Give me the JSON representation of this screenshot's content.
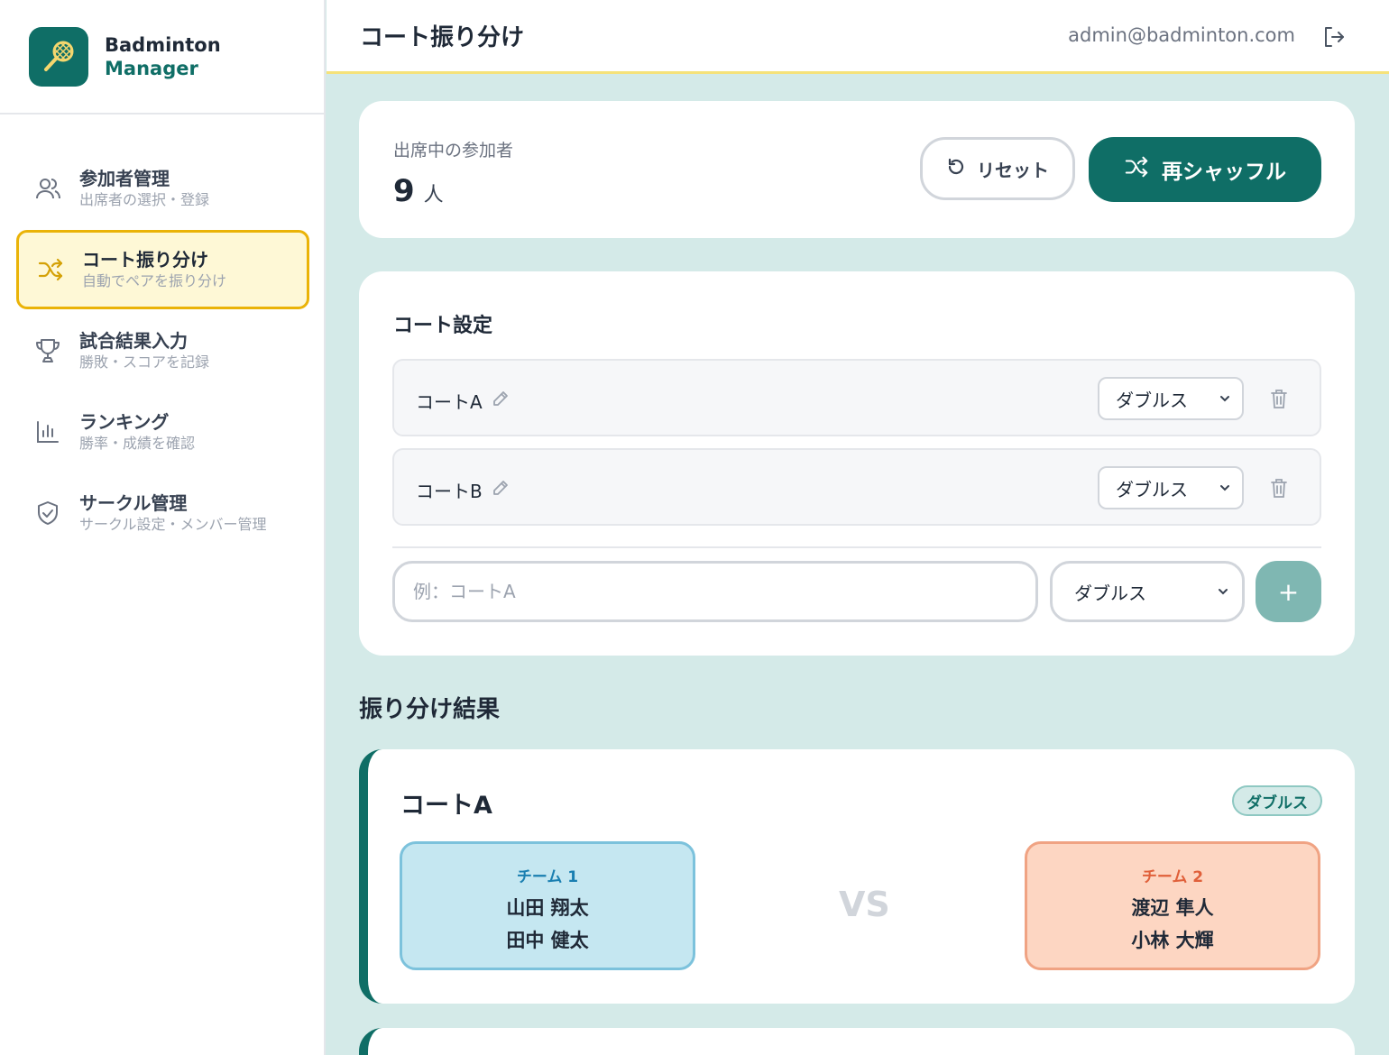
{
  "brand": {
    "line1": "Badminton",
    "line2": "Manager",
    "logo_icon": "badminton-racket-icon"
  },
  "colors": {
    "primary": "#0f6e66",
    "active_nav_bg": "#fef8d6",
    "active_nav_border": "#eab308",
    "team1": "#c5e7f1",
    "team2": "#fdd6c2"
  },
  "sidebar": {
    "items": [
      {
        "title": "参加者管理",
        "sub": "出席者の選択・登録",
        "icon": "users-icon"
      },
      {
        "title": "コート振り分け",
        "sub": "自動でペアを振り分け",
        "icon": "shuffle-icon"
      },
      {
        "title": "試合結果入力",
        "sub": "勝敗・スコアを記録",
        "icon": "trophy-icon"
      },
      {
        "title": "ランキング",
        "sub": "勝率・成績を確認",
        "icon": "bar-chart-icon"
      },
      {
        "title": "サークル管理",
        "sub": "サークル設定・メンバー管理",
        "icon": "shield-icon"
      }
    ]
  },
  "header": {
    "title": "コート振り分け",
    "email": "admin@badminton.com"
  },
  "attendance": {
    "label": "出席中の参加者",
    "count": "9",
    "unit": "人",
    "reset_label": "リセット",
    "shuffle_label": "再シャッフル"
  },
  "court_settings": {
    "title": "コート設定",
    "courts": [
      {
        "name": "コートA",
        "type": "ダブルス"
      },
      {
        "name": "コートB",
        "type": "ダブルス"
      }
    ],
    "new_court": {
      "placeholder": "例：コートA",
      "type": "ダブルス",
      "add_label": "+"
    }
  },
  "results": {
    "title": "振り分け結果",
    "courts": [
      {
        "name": "コートA",
        "type": "ダブルス",
        "vs": "VS",
        "team1": {
          "label": "チーム 1",
          "players": [
            "山田 翔太",
            "田中 健太"
          ]
        },
        "team2": {
          "label": "チーム 2",
          "players": [
            "渡辺 隼人",
            "小林 大輝"
          ]
        }
      }
    ]
  }
}
